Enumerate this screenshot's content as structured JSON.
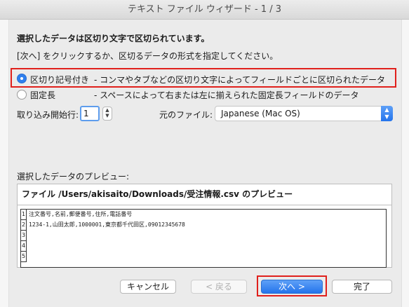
{
  "window": {
    "title": "テキスト ファイル ウィザード - 1 / 3"
  },
  "intro": {
    "heading": "選択したデータは区切り文字で区切られています。",
    "instruction": "[次へ] をクリックするか、区切るデータの形式を指定してください。"
  },
  "format": {
    "delimited": {
      "label": "区切り記号付き",
      "description": "- コンマやタブなどの区切り文字によってフィールドごとに区切られたデータ",
      "selected": true
    },
    "fixed": {
      "label": "固定長",
      "description": "- スペースによって右または左に揃えられた固定長フィールドのデータ",
      "selected": false
    }
  },
  "start_row": {
    "label": "取り込み開始行:",
    "value": "1"
  },
  "origin": {
    "label": "元のファイル:",
    "value": "Japanese (Mac OS)"
  },
  "preview": {
    "section_label": "選択したデータのプレビュー:",
    "title": "ファイル /Users/akisaito/Downloads/受注情報.csv のプレビュー",
    "rows": [
      {
        "num": "1",
        "text": "注文番号,名前,郵便番号,住所,電話番号"
      },
      {
        "num": "2",
        "text": "1234-1,山田太郎,1000001,東京都千代田区,09012345678"
      },
      {
        "num": "3",
        "text": ""
      },
      {
        "num": "4",
        "text": ""
      },
      {
        "num": "5",
        "text": ""
      }
    ]
  },
  "buttons": {
    "cancel": "キャンセル",
    "back": "< 戻る",
    "next": "次へ >",
    "finish": "完了"
  }
}
